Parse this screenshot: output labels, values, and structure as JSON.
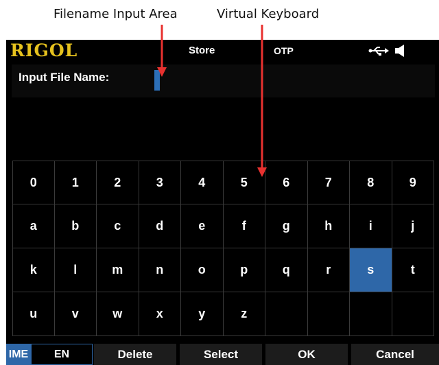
{
  "annotations": {
    "filename_input_area": "Filename Input Area",
    "virtual_keyboard": "Virtual Keyboard"
  },
  "header": {
    "logo": "RIGOL",
    "title": "Store",
    "status": "OTP",
    "icons": [
      "usb-icon",
      "speaker-icon"
    ]
  },
  "input": {
    "label": "Input File Name:",
    "value": ""
  },
  "keyboard": {
    "rows": [
      [
        "0",
        "1",
        "2",
        "3",
        "4",
        "5",
        "6",
        "7",
        "8",
        "9"
      ],
      [
        "a",
        "b",
        "c",
        "d",
        "e",
        "f",
        "g",
        "h",
        "i",
        "j"
      ],
      [
        "k",
        "l",
        "m",
        "n",
        "o",
        "p",
        "q",
        "r",
        "s",
        "t"
      ],
      [
        "u",
        "v",
        "w",
        "x",
        "y",
        "z",
        "",
        "",
        "",
        ""
      ]
    ],
    "selected_key": "s"
  },
  "softkeys": {
    "ime_tag": "IME",
    "ime_lang": "EN",
    "delete": "Delete",
    "select": "Select",
    "ok": "OK",
    "cancel": "Cancel"
  },
  "colors": {
    "logo": "#e6c21e",
    "accent": "#2e67a8",
    "arrow": "#e8312f",
    "screen_bg": "#000000"
  }
}
